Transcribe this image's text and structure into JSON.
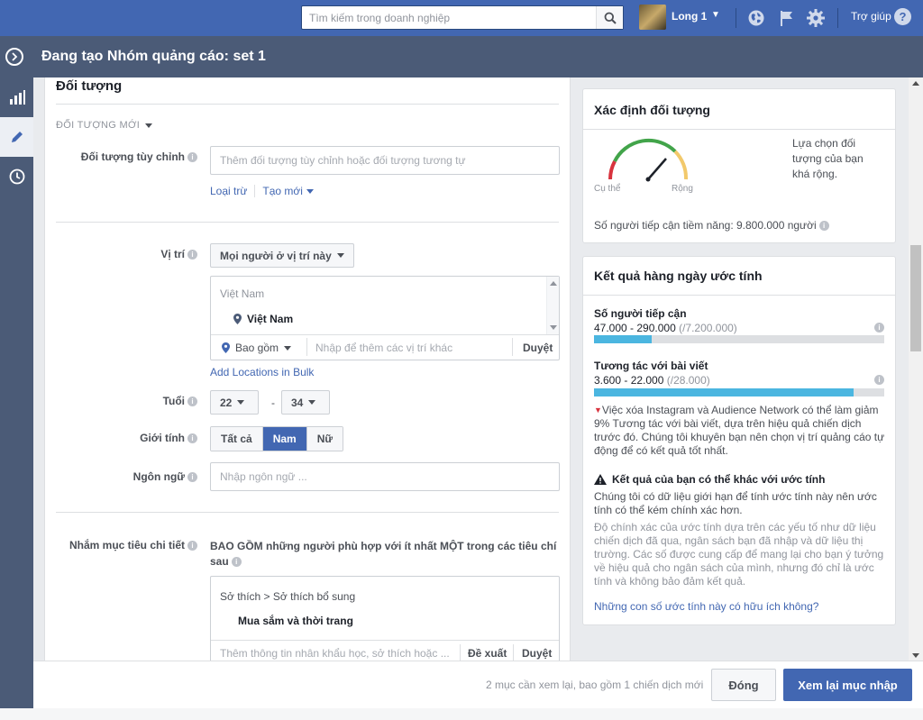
{
  "topbar": {
    "search_placeholder": "Tìm kiếm trong doanh nghiệp",
    "user_name": "Long 1",
    "help_label": "Trợ giúp",
    "help_symbol": "?"
  },
  "subbar": {
    "title": "Đang tạo Nhóm quảng cáo: set 1"
  },
  "form": {
    "section_title": "Đối tượng",
    "new_audience_label": "ĐỐI TƯỢNG MỚI",
    "custom_audience_label": "Đối tượng tùy chỉnh",
    "custom_audience_placeholder": "Thêm đối tượng tùy chỉnh hoặc đối tượng tương tự",
    "exclude_link": "Loại trừ",
    "create_new_link": "Tạo mới",
    "location_label": "Vị trí",
    "location_mode": "Mọi người ở vị trí này",
    "location_list_header": "Việt Nam",
    "location_selected": "Việt Nam",
    "location_include": "Bao gồm",
    "location_placeholder": "Nhập để thêm các vị trí khác",
    "browse_label": "Duyệt",
    "bulk_link": "Add Locations in Bulk",
    "age_label": "Tuổi",
    "age_min": "22",
    "age_max": "34",
    "age_dash": "-",
    "gender_label": "Giới tính",
    "gender_options": [
      "Tất cả",
      "Nam",
      "Nữ"
    ],
    "language_label": "Ngôn ngữ",
    "language_placeholder": "Nhập ngôn ngữ ...",
    "detailed_label": "Nhắm mục tiêu chi tiết",
    "detailed_desc": "BAO GỒM những người phù hợp với ít nhất MỘT trong các tiêu chí sau",
    "interest_path": "Sở thích > Sở thích bổ sung",
    "interest_item": "Mua sắm và thời trang",
    "interest_placeholder": "Thêm thông tin nhân khẩu học, sở thích hoặc ...",
    "suggest_label": "Đề xuất",
    "browse_label_2": "Duyệt"
  },
  "definition_card": {
    "title": "Xác định đối tượng",
    "gauge_left": "Cụ thể",
    "gauge_right": "Rộng",
    "gauge_desc": "Lựa chọn đối tượng của bạn khá rộng.",
    "potential_reach": "Số người tiếp cận tiềm năng: 9.800.000 người"
  },
  "results_card": {
    "title": "Kết quả hàng ngày ước tính",
    "reach_label": "Số người tiếp cận",
    "reach_value": "47.000 - 290.000",
    "reach_total": "(/7.200.000)",
    "reach_fill": 0.2,
    "engagement_label": "Tương tác với bài viết",
    "engagement_value": "3.600 - 22.000",
    "engagement_total": "(/28.000)",
    "engagement_fill": 0.893,
    "notice_text": "Việc xóa Instagram và Audience Network có thể làm giảm 9% Tương tác với bài viết, dựa trên hiệu quả chiến dịch trước đó. Chúng tôi khuyên bạn nên chọn vị trí quảng cáo tự động để có kết quả tốt nhất.",
    "warning_title": "Kết quả của bạn có thể khác với ước tính",
    "warning_text_1": "Chúng tôi có dữ liệu giới hạn để tính ước tính này nên ước tính có thể kém chính xác hơn.",
    "warning_text_2": "Độ chính xác của ước tính dựa trên các yếu tố như dữ liệu chiến dịch đã qua, ngân sách bạn đã nhập và dữ liệu thị trường. Các số được cung cấp để mang lại cho bạn ý tưởng về hiệu quả cho ngân sách của mình, nhưng đó chỉ là ước tính và không bảo đảm kết quả.",
    "feedback_link": "Những con số ước tính này có hữu ích không?",
    "bar_color": "#4bb6e0"
  },
  "footer": {
    "note": "2 mục cần xem lại, bao gồm 1 chiến dịch mới",
    "close_label": "Đóng",
    "review_label": "Xem lại mục nhập"
  }
}
